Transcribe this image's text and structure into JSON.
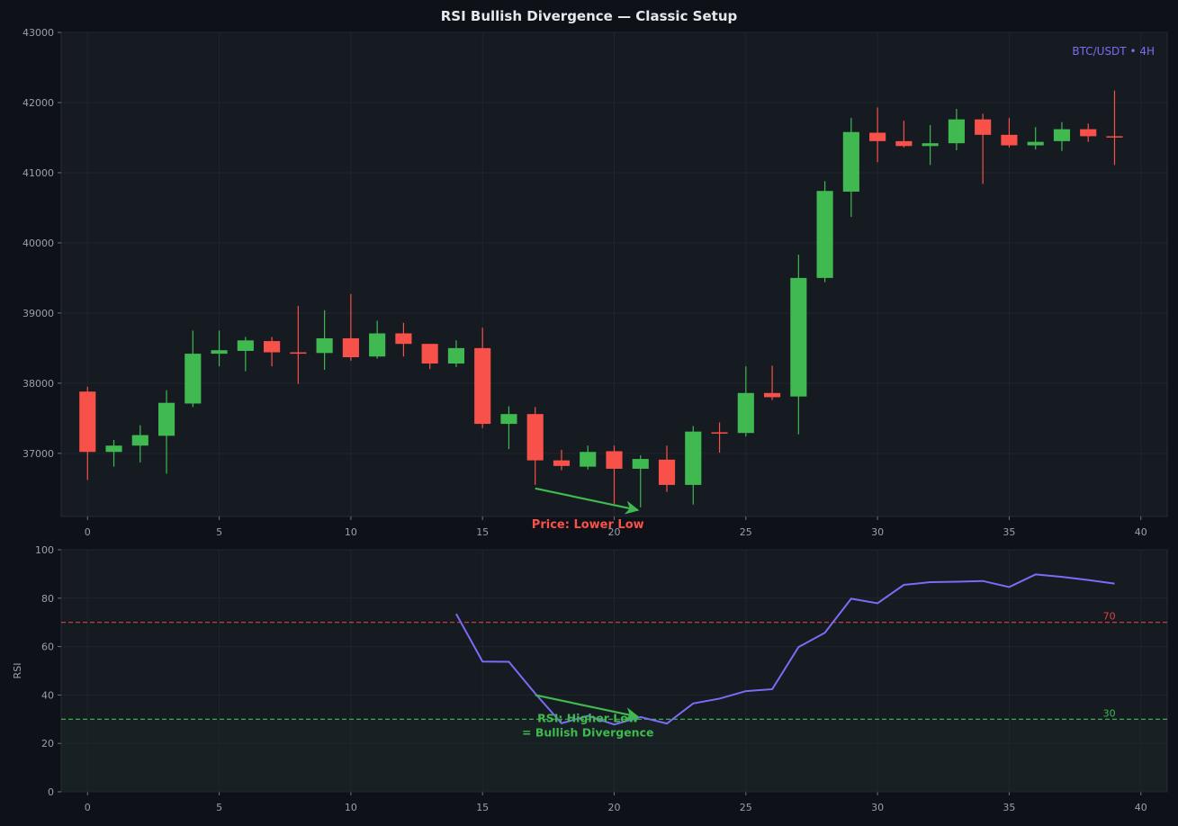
{
  "title": "RSI Bullish Divergence — Classic Setup",
  "colors": {
    "background": "#0e1118",
    "panel": "#161a21",
    "grid": "#20252e",
    "bull": "#3fb950",
    "bear": "#f85149",
    "rsi_line": "#7b6cf6",
    "symbol": "#7b6cf6"
  },
  "chart_data": [
    {
      "type": "candlestick",
      "symbol_label": "BTC/USDT • 4H",
      "xlim": [
        -1,
        41
      ],
      "ylim": [
        36100,
        43000
      ],
      "x_ticks": [
        0,
        5,
        10,
        15,
        20,
        25,
        30,
        35,
        40
      ],
      "y_ticks": [
        37000,
        38000,
        39000,
        40000,
        41000,
        42000,
        43000
      ],
      "grid": true,
      "candles": [
        {
          "x": 0,
          "open": 37880,
          "high": 37950,
          "low": 36620,
          "close": 37020
        },
        {
          "x": 1,
          "open": 37020,
          "high": 37190,
          "low": 36810,
          "close": 37110
        },
        {
          "x": 2,
          "open": 37110,
          "high": 37400,
          "low": 36870,
          "close": 37260
        },
        {
          "x": 3,
          "open": 37250,
          "high": 37900,
          "low": 36710,
          "close": 37720
        },
        {
          "x": 4,
          "open": 37710,
          "high": 38750,
          "low": 37660,
          "close": 38420
        },
        {
          "x": 5,
          "open": 38420,
          "high": 38750,
          "low": 38240,
          "close": 38470
        },
        {
          "x": 6,
          "open": 38460,
          "high": 38660,
          "low": 38170,
          "close": 38610
        },
        {
          "x": 7,
          "open": 38600,
          "high": 38660,
          "low": 38240,
          "close": 38440
        },
        {
          "x": 8,
          "open": 38440,
          "high": 39100,
          "low": 37990,
          "close": 38420
        },
        {
          "x": 9,
          "open": 38430,
          "high": 39040,
          "low": 38190,
          "close": 38640
        },
        {
          "x": 10,
          "open": 38640,
          "high": 39270,
          "low": 38320,
          "close": 38370
        },
        {
          "x": 11,
          "open": 38380,
          "high": 38890,
          "low": 38350,
          "close": 38710
        },
        {
          "x": 12,
          "open": 38710,
          "high": 38860,
          "low": 38380,
          "close": 38560
        },
        {
          "x": 13,
          "open": 38560,
          "high": 38560,
          "low": 38200,
          "close": 38280
        },
        {
          "x": 14,
          "open": 38280,
          "high": 38610,
          "low": 38230,
          "close": 38500
        },
        {
          "x": 15,
          "open": 38500,
          "high": 38790,
          "low": 37360,
          "close": 37420
        },
        {
          "x": 16,
          "open": 37420,
          "high": 37670,
          "low": 37060,
          "close": 37560
        },
        {
          "x": 17,
          "open": 37560,
          "high": 37660,
          "low": 36550,
          "close": 36900
        },
        {
          "x": 18,
          "open": 36900,
          "high": 37050,
          "low": 36760,
          "close": 36820
        },
        {
          "x": 19,
          "open": 36810,
          "high": 37110,
          "low": 36770,
          "close": 37020
        },
        {
          "x": 20,
          "open": 37030,
          "high": 37110,
          "low": 36280,
          "close": 36780
        },
        {
          "x": 21,
          "open": 36780,
          "high": 36970,
          "low": 36230,
          "close": 36920
        },
        {
          "x": 22,
          "open": 36910,
          "high": 37110,
          "low": 36450,
          "close": 36550
        },
        {
          "x": 23,
          "open": 36550,
          "high": 37390,
          "low": 36270,
          "close": 37310
        },
        {
          "x": 24,
          "open": 37300,
          "high": 37440,
          "low": 37010,
          "close": 37290
        },
        {
          "x": 25,
          "open": 37290,
          "high": 38240,
          "low": 37240,
          "close": 37860
        },
        {
          "x": 26,
          "open": 37860,
          "high": 38250,
          "low": 37760,
          "close": 37800
        },
        {
          "x": 27,
          "open": 37810,
          "high": 39830,
          "low": 37270,
          "close": 39500
        },
        {
          "x": 28,
          "open": 39500,
          "high": 40880,
          "low": 39440,
          "close": 40740
        },
        {
          "x": 29,
          "open": 40730,
          "high": 41780,
          "low": 40370,
          "close": 41580
        },
        {
          "x": 30,
          "open": 41570,
          "high": 41930,
          "low": 41150,
          "close": 41450
        },
        {
          "x": 31,
          "open": 41450,
          "high": 41740,
          "low": 41360,
          "close": 41380
        },
        {
          "x": 32,
          "open": 41380,
          "high": 41680,
          "low": 41110,
          "close": 41420
        },
        {
          "x": 33,
          "open": 41420,
          "high": 41910,
          "low": 41320,
          "close": 41760
        },
        {
          "x": 34,
          "open": 41760,
          "high": 41840,
          "low": 40840,
          "close": 41540
        },
        {
          "x": 35,
          "open": 41540,
          "high": 41780,
          "low": 41360,
          "close": 41390
        },
        {
          "x": 36,
          "open": 41390,
          "high": 41650,
          "low": 41330,
          "close": 41440
        },
        {
          "x": 37,
          "open": 41450,
          "high": 41720,
          "low": 41310,
          "close": 41620
        },
        {
          "x": 38,
          "open": 41620,
          "high": 41700,
          "low": 41440,
          "close": 41520
        },
        {
          "x": 39,
          "open": 41520,
          "high": 42170,
          "low": 41110,
          "close": 41510
        }
      ],
      "annotation": {
        "text": "Price: Lower Low",
        "color": "#f85149",
        "arrow_from": [
          17.0,
          36500
        ],
        "arrow_to": [
          20.9,
          36190
        ],
        "text_pos": [
          19.0,
          36000
        ]
      }
    },
    {
      "type": "line",
      "ylabel": "RSI",
      "xlim": [
        -1,
        41
      ],
      "ylim": [
        0,
        100
      ],
      "x_ticks": [
        0,
        5,
        10,
        15,
        20,
        25,
        30,
        35,
        40
      ],
      "y_ticks": [
        0,
        20,
        40,
        60,
        80,
        100
      ],
      "grid": true,
      "x": [
        14,
        15,
        16,
        17,
        18,
        19,
        20,
        21,
        22,
        23,
        24,
        25,
        26,
        27,
        28,
        29,
        30,
        31,
        32,
        33,
        34,
        35,
        36,
        37,
        38,
        39
      ],
      "y": [
        73.5,
        53.8,
        53.7,
        40.6,
        28.3,
        31.4,
        27.8,
        30.9,
        28.2,
        36.5,
        38.5,
        41.6,
        42.4,
        59.8,
        65.7,
        79.8,
        77.9,
        85.5,
        86.6,
        86.8,
        87.1,
        84.6,
        89.8,
        88.8,
        87.5,
        86.0
      ],
      "levels": [
        {
          "value": 70,
          "label": "70",
          "color": "#d9443f"
        },
        {
          "value": 30,
          "label": "30",
          "color": "#3fb950"
        }
      ],
      "annotation": {
        "lines": [
          "RSI: Higher Low",
          "= Bullish Divergence"
        ],
        "color": "#3fb950",
        "arrow_from": [
          17.0,
          40
        ],
        "arrow_to": [
          20.9,
          31
        ],
        "text_pos": [
          19.0,
          30
        ]
      }
    }
  ]
}
